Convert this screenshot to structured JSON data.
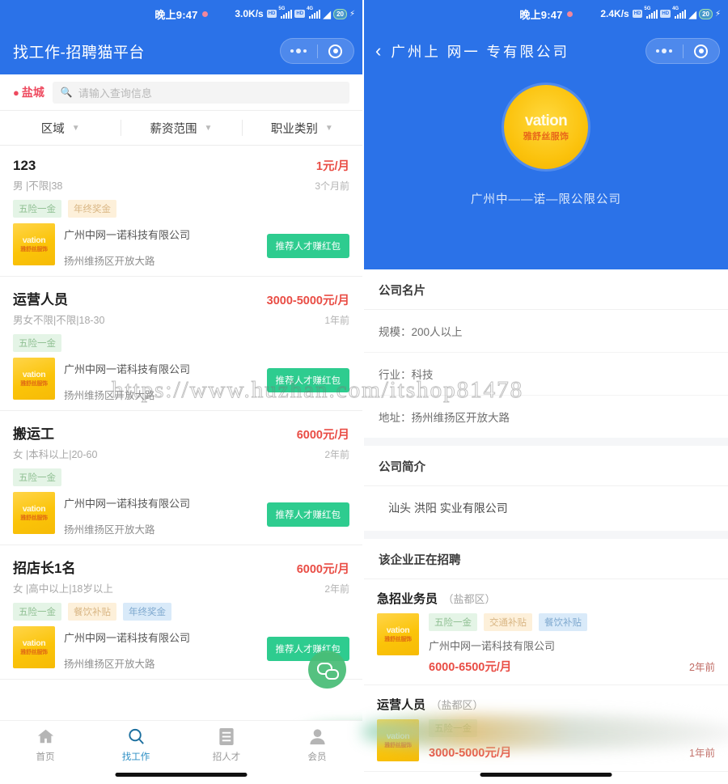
{
  "watermark": {
    "url": "https://www.huzhan.com/itshop81478"
  },
  "left": {
    "status_bar": {
      "time": "晚上9:47",
      "net_speed": "3.0K/s",
      "hd_badge": "HD",
      "sim1_gen": "5G",
      "sim2_gen": "4G",
      "battery": "20"
    },
    "app_bar": {
      "title": "找工作-招聘猫平台"
    },
    "search": {
      "city": "盐城",
      "placeholder": "请输入查询信息"
    },
    "filters": [
      {
        "label": "区域"
      },
      {
        "label": "薪资范围"
      },
      {
        "label": "职业类别"
      }
    ],
    "jobs": [
      {
        "title": "123",
        "salary": "1元/月",
        "requirements": "男 |不限|38",
        "posted": "3个月前",
        "tags": [
          {
            "label": "五险一金",
            "style": "green"
          },
          {
            "label": "年终奖金",
            "style": "orange"
          }
        ],
        "company": "广州中网一诺科技有限公司",
        "address": "扬州维扬区开放大路",
        "cta": "推荐人才赚红包"
      },
      {
        "title": "运营人员",
        "salary": "3000-5000元/月",
        "requirements": "男女不限|不限|18-30",
        "posted": "1年前",
        "tags": [
          {
            "label": "五险一金",
            "style": "green"
          }
        ],
        "company": "广州中网一诺科技有限公司",
        "address": "扬州维扬区开放大路",
        "cta": "推荐人才赚红包"
      },
      {
        "title": "搬运工",
        "salary": "6000元/月",
        "requirements": "女 |本科以上|20-60",
        "posted": "2年前",
        "tags": [
          {
            "label": "五险一金",
            "style": "green"
          }
        ],
        "company": "广州中网一诺科技有限公司",
        "address": "扬州维扬区开放大路",
        "cta": "推荐人才赚红包"
      },
      {
        "title": "招店长1名",
        "salary": "6000元/月",
        "requirements": "女 |高中以上|18岁以上",
        "posted": "2年前",
        "tags": [
          {
            "label": "五险一金",
            "style": "green"
          },
          {
            "label": "餐饮补贴",
            "style": "orange"
          },
          {
            "label": "年终奖金",
            "style": "blue"
          }
        ],
        "company": "广州中网一诺科技有限公司",
        "address": "扬州维扬区开放大路",
        "cta": "推荐人才赚红包"
      }
    ],
    "logo": {
      "en": "vation",
      "cn": "雅舒丝服饰"
    },
    "fab": {
      "name": "chat-bubbles"
    },
    "tabbar": [
      {
        "label": "首页",
        "icon": "home-icon",
        "active": false
      },
      {
        "label": "找工作",
        "icon": "search-icon",
        "active": true
      },
      {
        "label": "招人才",
        "icon": "list-icon",
        "active": false
      },
      {
        "label": "会员",
        "icon": "person-icon",
        "active": false
      }
    ]
  },
  "right": {
    "status_bar": {
      "time": "晚上9:47",
      "net_speed": "2.4K/s",
      "hd_badge": "HD",
      "sim1_gen": "5G",
      "sim2_gen": "4G",
      "battery": "20"
    },
    "app_bar": {
      "title": "广州上 网一  专有限公司"
    },
    "hero": {
      "logo_en": "vation",
      "logo_cn": "雅舒丝服饰",
      "company_name": "广州中——诺—限公限公司"
    },
    "card": {
      "heading": "公司名片",
      "rows": [
        "规模：200人以上",
        "行业：科技",
        "地址：扬州维扬区开放大路"
      ]
    },
    "intro": {
      "heading": "公司简介",
      "text": "汕头   洪阳   实业有限公司"
    },
    "hiring": {
      "heading": "该企业正在招聘",
      "jobs": [
        {
          "title": "急招业务员",
          "area": "（盐都区）",
          "tags": [
            {
              "label": "五险一金",
              "style": "green"
            },
            {
              "label": "交通补贴",
              "style": "orange"
            },
            {
              "label": "餐饮补贴",
              "style": "blue"
            }
          ],
          "company": "广州中网一诺科技有限公司",
          "salary": "6000-6500元/月",
          "posted": "2年前"
        },
        {
          "title": "运营人员",
          "area": "（盐都区）",
          "tags": [
            {
              "label": "五险一金",
              "style": "green"
            }
          ],
          "company": "",
          "salary": "3000-5000元/月",
          "posted": "1年前"
        }
      ]
    }
  }
}
